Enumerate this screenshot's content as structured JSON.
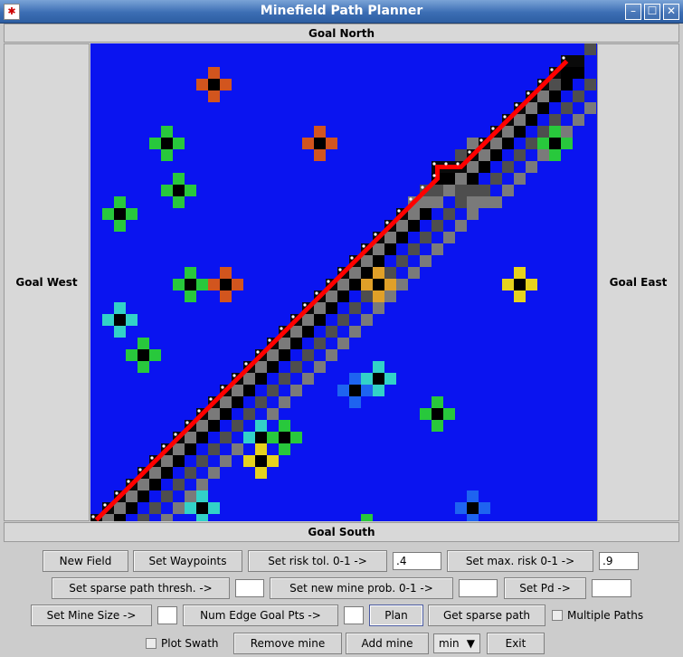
{
  "window": {
    "title": "Minefield Path Planner",
    "controls": [
      "–",
      "☐",
      "✕"
    ]
  },
  "regions": {
    "north": "Goal North",
    "south": "Goal South",
    "west": "Goal West",
    "east": "Goal East"
  },
  "controls": {
    "new_field": "New Field",
    "set_waypoints": "Set Waypoints",
    "set_risk_tol": "Set risk tol. 0-1 ->",
    "risk_tol_value": ".4",
    "set_max_risk": "Set max. risk 0-1 ->",
    "max_risk_value": ".9",
    "set_sparse_thresh": "Set sparse path thresh. ->",
    "sparse_thresh_value": "",
    "set_new_mine_prob": "Set new mine prob. 0-1 ->",
    "new_mine_prob_value": "",
    "set_pd": "Set Pd ->",
    "pd_value": "",
    "set_mine_size": "Set Mine Size ->",
    "mine_size_value": "",
    "num_edge_goal_pts": "Num Edge Goal Pts ->",
    "num_edge_value": "",
    "plan": "Plan",
    "get_sparse_path": "Get sparse path",
    "multiple_paths": "Multiple Paths",
    "plot_swath": "Plot Swath",
    "remove_mine": "Remove mine",
    "add_mine": "Add mine",
    "mode_select": "min",
    "exit": "Exit"
  },
  "colors": {
    "field_bg": "#0a14f0",
    "path_red": "#ff0000",
    "path_white": "#ffffff"
  },
  "mines": [
    {
      "c": 10,
      "r": 3,
      "color": "#d2551e"
    },
    {
      "c": 6,
      "r": 8,
      "color": "#28c83c"
    },
    {
      "c": 19,
      "r": 8,
      "color": "#d2551e"
    },
    {
      "c": 7,
      "r": 12,
      "color": "#28c83c"
    },
    {
      "c": 2,
      "r": 14,
      "color": "#28c83c"
    },
    {
      "c": 39,
      "r": 8,
      "color": "#28c83c"
    },
    {
      "c": 8,
      "r": 20,
      "color": "#28c83c"
    },
    {
      "c": 11,
      "r": 20,
      "color": "#d2551e"
    },
    {
      "c": 24,
      "r": 20,
      "color": "#e0a028"
    },
    {
      "c": 36,
      "r": 20,
      "color": "#e6d21e"
    },
    {
      "c": 2,
      "r": 23,
      "color": "#32d2c8"
    },
    {
      "c": 4,
      "r": 26,
      "color": "#28c83c"
    },
    {
      "c": 22,
      "r": 29,
      "color": "#1e64f0"
    },
    {
      "c": 24,
      "r": 28,
      "color": "#32d2c8"
    },
    {
      "c": 29,
      "r": 31,
      "color": "#28c83c"
    },
    {
      "c": 14,
      "r": 33,
      "color": "#32d2c8"
    },
    {
      "c": 16,
      "r": 33,
      "color": "#28c83c"
    },
    {
      "c": 14,
      "r": 35,
      "color": "#e6d21e"
    },
    {
      "c": 9,
      "r": 39,
      "color": "#32d2c8"
    },
    {
      "c": 32,
      "r": 39,
      "color": "#1e64f0"
    },
    {
      "c": 23,
      "r": 41,
      "color": "#28c83c"
    }
  ],
  "path": [
    {
      "c": 0,
      "r": 40
    },
    {
      "c": 8,
      "r": 32
    },
    {
      "c": 28,
      "r": 12
    },
    {
      "c": 29,
      "r": 10
    },
    {
      "c": 31,
      "r": 10
    },
    {
      "c": 40,
      "r": 1
    }
  ]
}
